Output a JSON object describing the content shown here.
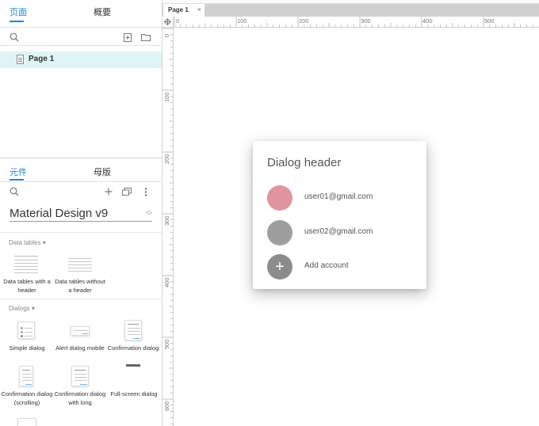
{
  "pages_panel": {
    "tab_pages": "页面",
    "tab_outline": "概要",
    "page_item": "Page 1"
  },
  "library_panel": {
    "tab_widgets": "元件",
    "tab_masters": "母版",
    "library_name": "Material Design v9",
    "data_tables_section": "Data tables ▾",
    "dialogs_section": "Dialogs ▾",
    "widgets": {
      "dt_header": "Data tables with a header",
      "dt_noheader": "Data tables without a header",
      "simple_dialog": "Simple dialog",
      "alert_mobile": "Alert dialog mobile",
      "confirmation": "Confirmation dialog",
      "confirmation_scrolling": "Confirmation dialog (scrolling)",
      "confirmation_long": "Confirmation dialog with long",
      "fullscreen": "Full-screen dialog"
    }
  },
  "editor": {
    "doc_tab": "Page 1",
    "close_glyph": "×",
    "hruler_labels": [
      "0",
      "100",
      "200",
      "300",
      "400",
      "500"
    ],
    "vruler_labels": [
      "0",
      "100",
      "200",
      "300",
      "400",
      "500",
      "600"
    ]
  },
  "dialog": {
    "header": "Dialog header",
    "rows": [
      {
        "email": "user01@gmail.com",
        "avatar_color": "#e0949f"
      },
      {
        "email": "user02@gmail.com",
        "avatar_color": "#9e9e9e"
      }
    ],
    "add_label": "Add account",
    "add_color": "#8c8c8c",
    "add_glyph": "+"
  },
  "colors": {
    "accent": "#1a8ad6",
    "selected_row": "#dff4f5"
  }
}
